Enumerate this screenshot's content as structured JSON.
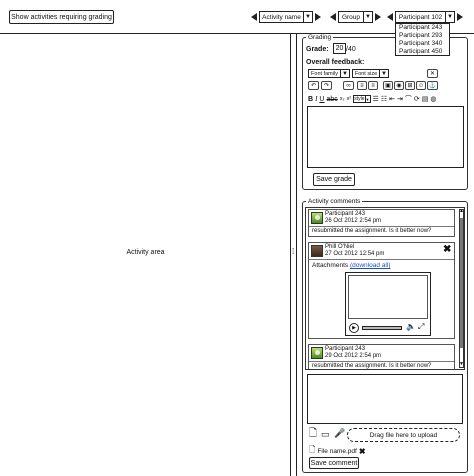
{
  "toolbar": {
    "show_requiring_grading_label": "Show activities requiring grading",
    "activity_select": "Activity name",
    "group_select": "Group",
    "participant_select": "Participant 102",
    "participant_options": [
      "Participant 243",
      "Participant 293",
      "Participant 340",
      "Participant 450"
    ]
  },
  "activity_area": {
    "label": "Activity area"
  },
  "grading": {
    "legend": "Grading",
    "grade_label": "Grade:",
    "grade_value": "20",
    "grade_max": "/40",
    "feedback_label": "Overall feedback:",
    "font_family_label": "Font family",
    "font_size_label": "Font size",
    "style_label": "style",
    "save_label": "Save grade"
  },
  "comments": {
    "legend": "Activity comments",
    "items": [
      {
        "author": "Participant 243",
        "date": "26 Oct 2012 2:54 pm",
        "text": "resubmitted the assignment.  Is it better now?"
      },
      {
        "author": "Phill O'Niel",
        "date": "27 Oct 2012 12:54 pm",
        "attachments_label": "Attachments",
        "download_all_label": "(download all)"
      },
      {
        "author": "Participant 243",
        "date": "29 Oct 2012 2:54 pm",
        "text": "resubmitted the assignment.  Is it better now?"
      }
    ],
    "drop_label": "Drag file here to upload",
    "file_name": "File name.pdf",
    "save_label": "Save comment"
  }
}
